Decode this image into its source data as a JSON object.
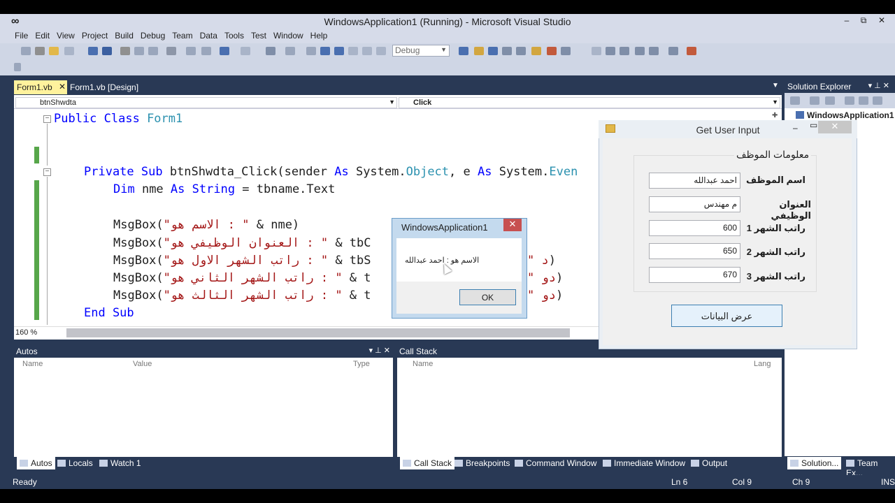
{
  "window": {
    "title": "WindowsApplication1 (Running) - Microsoft Visual Studio",
    "minimize": "‒",
    "restore": "⧉",
    "close": "✕"
  },
  "menu": [
    "File",
    "Edit",
    "View",
    "Project",
    "Build",
    "Debug",
    "Team",
    "Data",
    "Tools",
    "Test",
    "Window",
    "Help"
  ],
  "toolbar": {
    "config": "Debug"
  },
  "doc_tabs": [
    {
      "label": "Form1.vb",
      "close": "✕"
    },
    {
      "label": "Form1.vb [Design]"
    }
  ],
  "editor": {
    "nav_left": "btnShwdta",
    "nav_right": "Click",
    "zoom": "160 %",
    "lines": {
      "l1_kw": "Public Class",
      "l1_name": " Form1",
      "l4a": "Private Sub",
      "l4b": " btnShwdta_Click(sender ",
      "l4c": "As",
      "l4d": " System.",
      "l4e": "Object",
      "l4f": ", e ",
      "l4g": "As",
      "l4h": " System.",
      "l4i": "Even",
      "l5a": "Dim",
      "l5b": " nme ",
      "l5c": "As",
      "l5d": " ",
      "l5e": "String",
      "l5f": " = tbname.Text",
      "l7a": "MsgBox(",
      "l7b": "\"الاسم هو : \"",
      "l7c": " & nme)",
      "l8a": "MsgBox(",
      "l8b": "\"العنوان الوظيفي هو : \"",
      "l8c": " & tbC",
      "l9a": "MsgBox(",
      "l9b": "\"راتب الشهر الاول هو : \"",
      "l9c": " & tbS",
      "l9d": " ",
      "l9e": "\" د",
      "l9f": ")",
      "l10a": "MsgBox(",
      "l10b": "\"راتب الشهر الثاني هو : \"",
      "l10c": " & t",
      "l10d": "\" دو",
      "l10e": ")",
      "l11a": "MsgBox(",
      "l11b": "\"راتب الشهر الثالث هو : \"",
      "l11c": " & t",
      "l11d": "\" دو",
      "l11e": ")",
      "l12": "End Sub"
    }
  },
  "solution_explorer": {
    "title": "Solution Explorer",
    "item": "WindowsApplication1"
  },
  "form": {
    "title": "Get User Input",
    "group_title": "معلومات الموظف",
    "fields": [
      {
        "label": "اسم الموظف",
        "value": "احمد عبدالله"
      },
      {
        "label": "العنوان الوظيفي",
        "value": "م مهندس"
      },
      {
        "label": "راتب الشهر 1",
        "value": "600"
      },
      {
        "label": "راتب الشهر 2",
        "value": "650"
      },
      {
        "label": "راتب الشهر 3",
        "value": "670"
      }
    ],
    "button": "عرض البيانات"
  },
  "msgbox": {
    "title": "WindowsApplication1",
    "close": "✕",
    "text": "الاسم هو : احمد عبدالله",
    "ok": "OK"
  },
  "autos": {
    "title": "Autos",
    "columns": [
      "Name",
      "Value",
      "Type"
    ],
    "tabs": [
      "Autos",
      "Locals",
      "Watch 1"
    ]
  },
  "callstack": {
    "title": "Call Stack",
    "columns": [
      "Name",
      "Lang"
    ],
    "tabs": [
      "Call Stack",
      "Breakpoints",
      "Command Window",
      "Immediate Window",
      "Output"
    ]
  },
  "sol_tabs": [
    "Solution...",
    "Team Ex..."
  ],
  "status": {
    "ready": "Ready",
    "ln": "Ln 6",
    "col": "Col 9",
    "ch": "Ch 9",
    "ins": "INS"
  }
}
